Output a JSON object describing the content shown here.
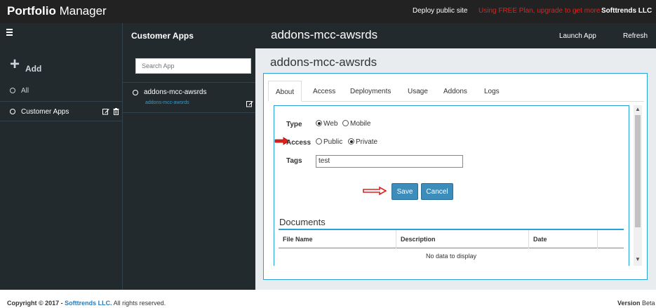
{
  "topbar": {
    "brand_bold": "Portfolio",
    "brand_rest": " Manager",
    "deploy_link": "Deploy public site",
    "upgrade_link": "Using FREE Plan, upgrade to get more",
    "company": "Softtrends LLC"
  },
  "sidebar": {
    "add_label": "Add",
    "items": [
      {
        "label": "All"
      },
      {
        "label": "Customer Apps"
      }
    ]
  },
  "applist": {
    "title": "Customer Apps",
    "search_placeholder": "Search App",
    "apps": [
      {
        "name": "addons-mcc-awsrds",
        "sub": "addons-mcc-awsrds"
      }
    ]
  },
  "main": {
    "header_title": "addons-mcc-awsrds",
    "launch_label": "Launch App",
    "refresh_label": "Refresh",
    "content_title": "addons-mcc-awsrds",
    "tabs": [
      {
        "label": "About",
        "active": true
      },
      {
        "label": "Access"
      },
      {
        "label": "Deployments"
      },
      {
        "label": "Usage"
      },
      {
        "label": "Addons"
      },
      {
        "label": "Logs"
      }
    ],
    "form": {
      "type_label": "Type",
      "type_options": [
        "Web",
        "Mobile"
      ],
      "type_selected": "Web",
      "access_label": "Access",
      "access_options": [
        "Public",
        "Private"
      ],
      "access_selected": "Private",
      "tags_label": "Tags",
      "tags_value": "test",
      "save_label": "Save",
      "cancel_label": "Cancel"
    },
    "documents": {
      "title": "Documents",
      "columns": [
        "File Name",
        "Description",
        "Date"
      ],
      "empty_text": "No data to display"
    }
  },
  "footer": {
    "copyright": "Copyright © 2017 - ",
    "company": "Softtrends LLC.",
    "rights": " All rights reserved.",
    "version_label": "Version",
    "version_value": " Beta"
  },
  "colors": {
    "topbar": "#222222",
    "sidebar": "#222a2e",
    "accent": "#29a3d6",
    "button": "#3c8dbc",
    "upgrade_text": "#e4201b",
    "arrow": "#e0201b"
  },
  "icons": [
    "menu-icon",
    "plus-icon",
    "edit-icon",
    "trash-icon",
    "red-arrow-icon"
  ]
}
